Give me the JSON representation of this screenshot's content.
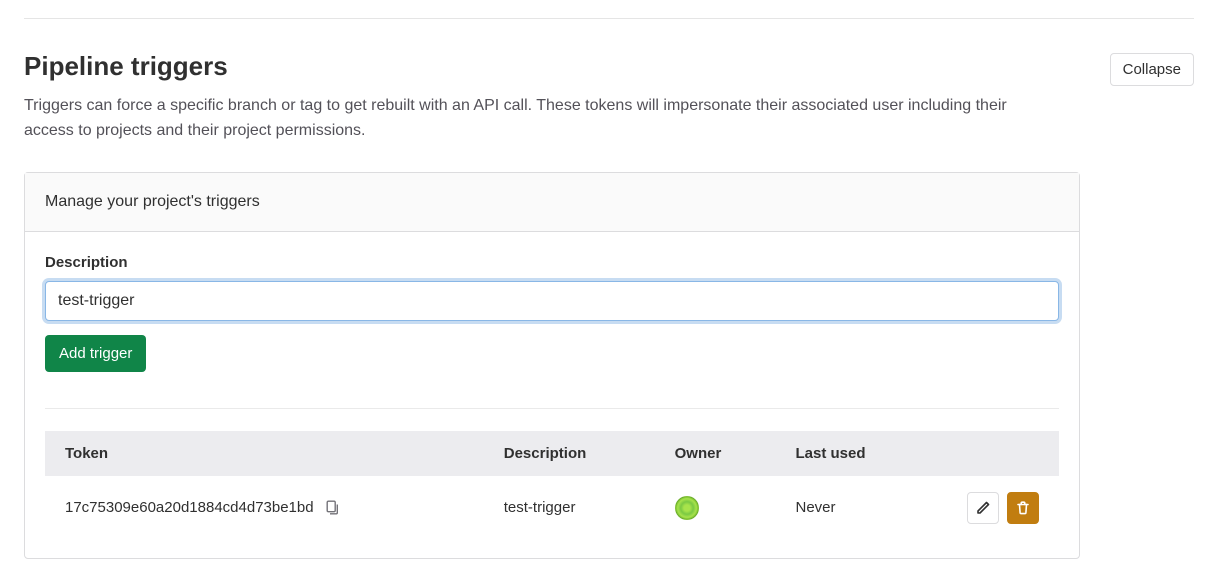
{
  "section": {
    "title": "Pipeline triggers",
    "subtitle": "Triggers can force a specific branch or tag to get rebuilt with an API call. These tokens will impersonate their associated user including their access to projects and their project permissions.",
    "collapse_label": "Collapse"
  },
  "panel": {
    "header": "Manage your project's triggers",
    "description_label": "Description",
    "description_value": "test-trigger",
    "add_button_label": "Add trigger"
  },
  "table": {
    "headers": {
      "token": "Token",
      "description": "Description",
      "owner": "Owner",
      "last_used": "Last used",
      "actions": ""
    },
    "rows": [
      {
        "token": "17c75309e60a20d1884cd4d73be1bd",
        "description": "test-trigger",
        "last_used": "Never"
      }
    ]
  }
}
